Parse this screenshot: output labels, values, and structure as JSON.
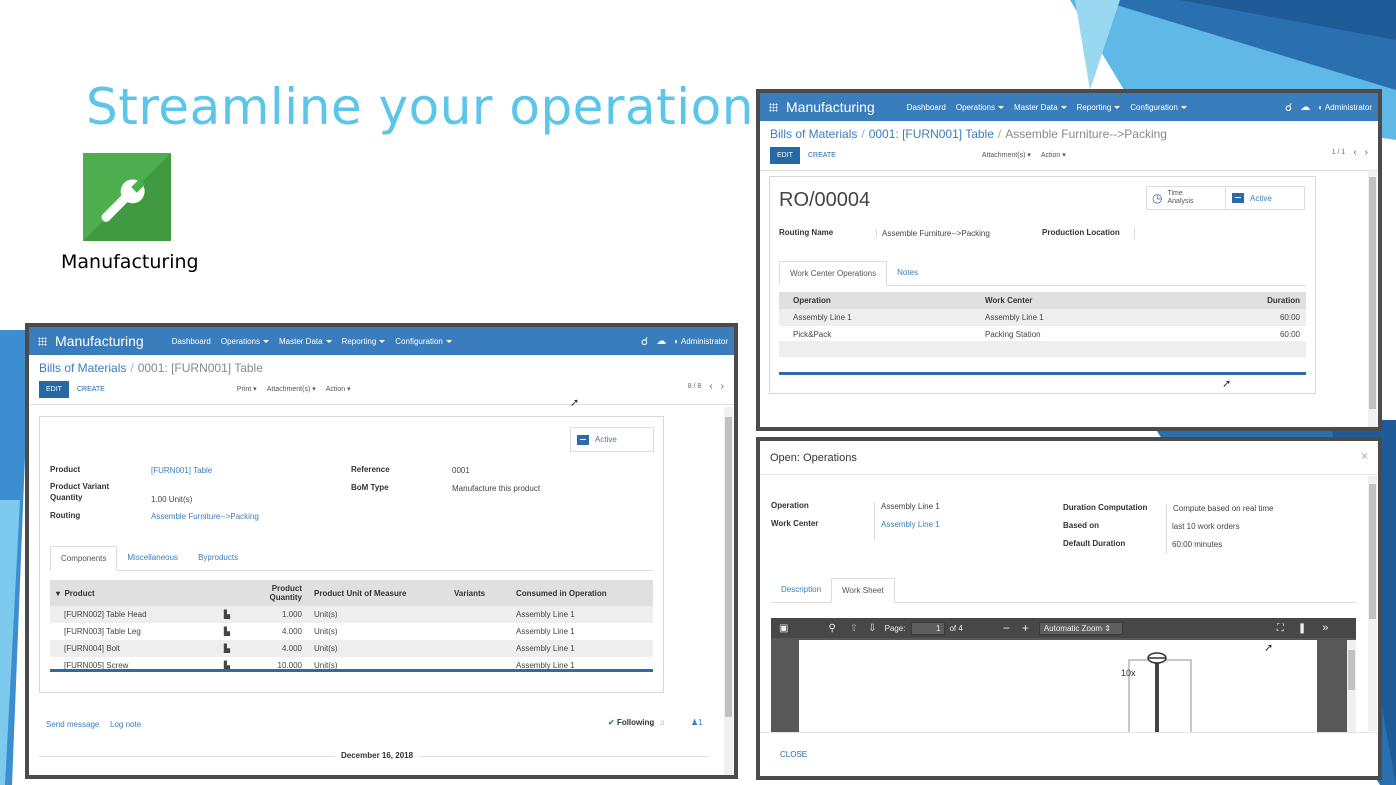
{
  "slide": {
    "headline": "Streamline your operation",
    "app_caption": "Manufacturing",
    "app_icon": "wrench-icon"
  },
  "colors": {
    "navbar": "#3a7dbd",
    "accent_blue": "#5bc5ea",
    "app_green": "#4cae4c"
  },
  "bom_window": {
    "navbar": {
      "brand": "Manufacturing",
      "menu": [
        "Dashboard",
        "Operations",
        "Master Data",
        "Reporting",
        "Configuration"
      ],
      "user": "Administrator"
    },
    "breadcrumb": {
      "root": "Bills of Materials",
      "current": "0001: [FURN001] Table"
    },
    "buttons": {
      "edit": "EDIT",
      "create": "CREATE",
      "print": "Print",
      "attachments": "Attachment(s)",
      "action": "Action"
    },
    "pager": "8 / 8",
    "status": "Active",
    "fields": {
      "product_label": "Product",
      "product_value": "[FURN001] Table",
      "variant_label_1": "Product Variant",
      "variant_label_2": "Quantity",
      "quantity_value": "1.00 Unit(s)",
      "routing_label": "Routing",
      "routing_value": "Assemble Furniture-->Packing",
      "reference_label": "Reference",
      "reference_value": "0001",
      "bomtype_label": "BoM Type",
      "bomtype_value": "Manufacture this product"
    },
    "tabs": [
      "Components",
      "Miscellaneous",
      "Byproducts"
    ],
    "columns": [
      "Product",
      "Product Quantity",
      "Product Unit of Measure",
      "Variants",
      "Consumed in Operation"
    ],
    "rows": [
      {
        "product": "[FURN002] Table Head",
        "qty": "1.000",
        "uom": "Unit(s)",
        "variants": "",
        "op": "Assembly Line 1"
      },
      {
        "product": "[FURN003] Table Leg",
        "qty": "4.000",
        "uom": "Unit(s)",
        "variants": "",
        "op": "Assembly Line 1"
      },
      {
        "product": "[FURN004] Bolt",
        "qty": "4.000",
        "uom": "Unit(s)",
        "variants": "",
        "op": "Assembly Line 1"
      },
      {
        "product": "[FURN005] Screw",
        "qty": "10.000",
        "uom": "Unit(s)",
        "variants": "",
        "op": "Assembly Line 1"
      }
    ],
    "chatter": {
      "send": "Send message",
      "log": "Log note",
      "following": "Following",
      "followers": "1",
      "date": "December 16, 2018"
    }
  },
  "routing_window": {
    "navbar": {
      "brand": "Manufacturing",
      "menu": [
        "Dashboard",
        "Operations",
        "Master Data",
        "Reporting",
        "Configuration"
      ],
      "user": "Administrator"
    },
    "breadcrumb": {
      "root": "Bills of Materials",
      "mid": "0001: [FURN001] Table",
      "current": "Assemble Furniture-->Packing"
    },
    "buttons": {
      "edit": "EDIT",
      "create": "CREATE",
      "attachments": "Attachment(s)",
      "action": "Action"
    },
    "pager": "1 / 1",
    "title": "RO/00004",
    "smart_time_1": "Time",
    "smart_time_2": "Analysis",
    "status": "Active",
    "fields": {
      "routing_name_label": "Routing Name",
      "routing_name_value": "Assemble Furniture-->Packing",
      "production_location_label": "Production Location"
    },
    "tabs": [
      "Work Center Operations",
      "Notes"
    ],
    "columns": [
      "Operation",
      "Work Center",
      "Duration"
    ],
    "rows": [
      {
        "operation": "Assembly Line 1",
        "workcenter": "Assembly Line 1",
        "duration": "60:00"
      },
      {
        "operation": "Pick&Pack",
        "workcenter": "Packing Station",
        "duration": "60:00"
      }
    ]
  },
  "operation_dialog": {
    "title": "Open: Operations",
    "fields": {
      "operation_label": "Operation",
      "operation_value": "Assembly Line 1",
      "workcenter_label": "Work Center",
      "workcenter_value": "Assembly Line 1",
      "duration_comp_label": "Duration Computation",
      "duration_comp_value": "Compute based on real time",
      "based_on_label": "Based on",
      "based_on_value": "last 10 work orders",
      "default_duration_label": "Default Duration",
      "default_duration_value": "60:00 minutes"
    },
    "tabs": [
      "Description",
      "Work Sheet"
    ],
    "pdf": {
      "page_label": "Page:",
      "page_value": "1",
      "of_pages": "of 4",
      "zoom": "Automatic Zoom",
      "annotation": "10x"
    },
    "close": "CLOSE"
  }
}
